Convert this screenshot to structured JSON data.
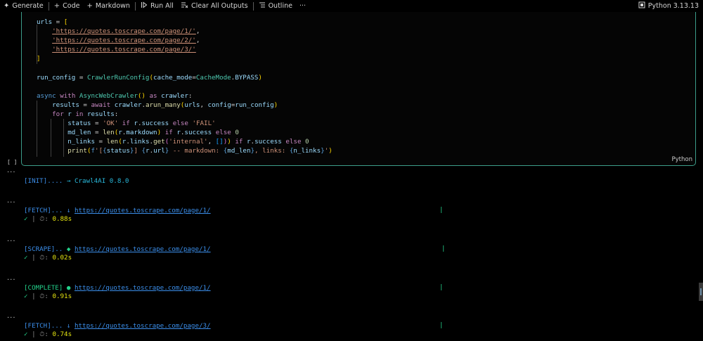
{
  "toolbar": {
    "generate": "Generate",
    "code": "Code",
    "markdown": "Markdown",
    "run_all": "Run All",
    "clear_all": "Clear All Outputs",
    "outline": "Outline",
    "more": "···",
    "kernel": "Python 3.13.13"
  },
  "cell": {
    "bracket": "[ ]",
    "language": "Python"
  },
  "outputs": {
    "ellipsis": "···",
    "init": {
      "tag": "[INIT]....",
      "arrow": "→",
      "text": "Crawl4AI 0.8.0"
    },
    "fetch1": {
      "tag": "[FETCH]...",
      "arrow": "↓",
      "url": "https://quotes.toscrape.com/page/1/",
      "check": "✓",
      "sep1": "|",
      "clock": "⏱:",
      "time": "0.88s"
    },
    "scrape1": {
      "tag": "[SCRAPE]..",
      "arrow": "◆",
      "url": "https://quotes.toscrape.com/page/1/",
      "check": "✓",
      "sep1": "|",
      "clock": "⏱:",
      "time": "0.02s"
    },
    "complete1": {
      "tag": "[COMPLETE]",
      "arrow": "●",
      "url": "https://quotes.toscrape.com/page/1/",
      "check": "✓",
      "sep1": "|",
      "clock": "⏱:",
      "time": "0.91s"
    },
    "fetch3": {
      "tag": "[FETCH]...",
      "arrow": "↓",
      "url": "https://quotes.toscrape.com/page/3/",
      "check": "✓",
      "sep1": "|",
      "clock": "⏱:",
      "time": "0.74s"
    },
    "pipe": "|"
  },
  "icons": {
    "generate": "sparkle-icon",
    "code": "plus-icon",
    "markdown": "plus-icon",
    "run_all": "run-all-icon",
    "clear": "clear-outputs-icon",
    "outline": "outline-icon",
    "kernel": "kernel-icon"
  },
  "colors": {
    "background": "#000000",
    "cell_border": "#3c9d8a",
    "keyword": "#569cd6",
    "string": "#ce9178",
    "output_blue": "#3b8eea",
    "output_green": "#23d18b",
    "output_yellow": "#e5e510"
  }
}
